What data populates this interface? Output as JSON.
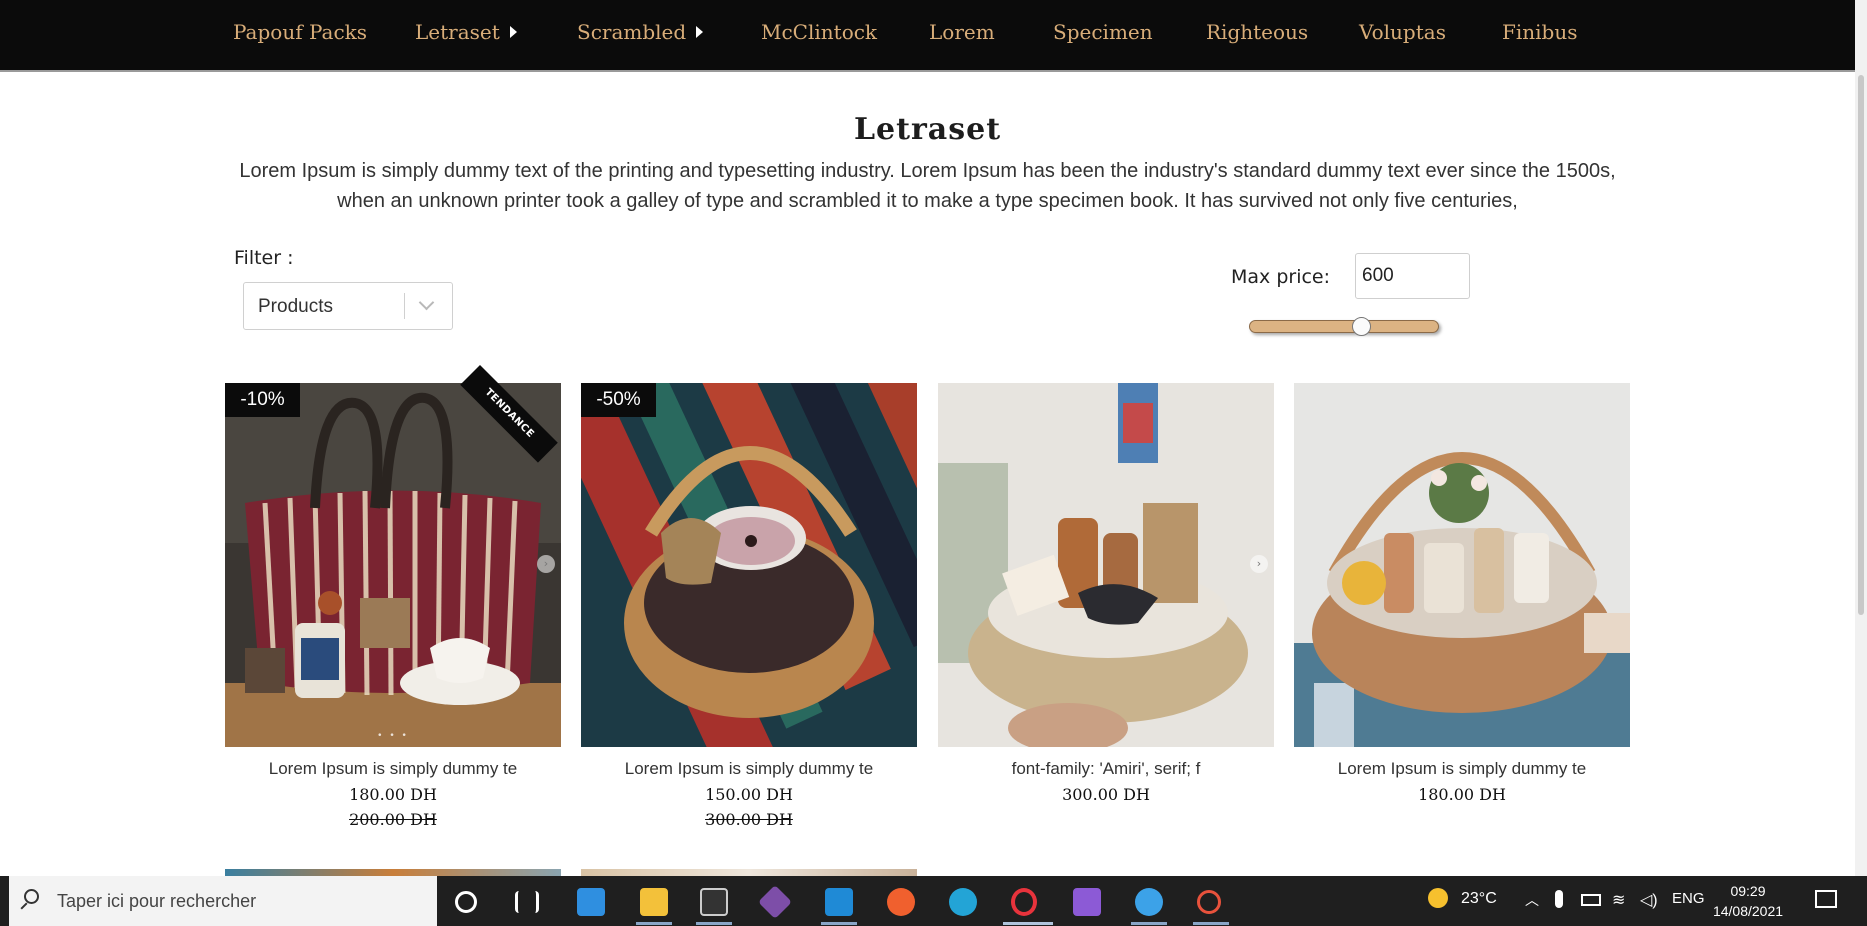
{
  "nav": {
    "items": [
      {
        "label": "Papouf Packs",
        "has_submenu": false
      },
      {
        "label": "Letraset",
        "has_submenu": true
      },
      {
        "label": "Scrambled",
        "has_submenu": true
      },
      {
        "label": "McClintock",
        "has_submenu": false
      },
      {
        "label": "Lorem",
        "has_submenu": false
      },
      {
        "label": "Specimen",
        "has_submenu": false
      },
      {
        "label": "Righteous",
        "has_submenu": false
      },
      {
        "label": "Voluptas",
        "has_submenu": false
      },
      {
        "label": "Finibus",
        "has_submenu": false
      }
    ],
    "text_color": "#d8ad79",
    "background": "#0b0b0b"
  },
  "page": {
    "title": "Letraset",
    "intro_line1": "Lorem Ipsum is simply dummy text of the printing and typesetting industry. Lorem Ipsum has been the industry's standard dummy text ever since the 1500s,",
    "intro_line2": "when an unknown printer took a galley of type and scrambled it to make a type specimen book. It has survived not only five centuries,"
  },
  "filter": {
    "label": "Filter :",
    "selected": "Products"
  },
  "price": {
    "label": "Max price:",
    "value": "600",
    "slider_fraction": 0.6
  },
  "products": [
    {
      "title": "Lorem Ipsum is simply dummy te",
      "price": "180.00 DH",
      "old_price": "200.00 DH",
      "discount": "-10%",
      "ribbon": "TENDANCE"
    },
    {
      "title": "Lorem Ipsum is simply dummy te",
      "price": "150.00 DH",
      "old_price": "300.00 DH",
      "discount": "-50%",
      "ribbon": ""
    },
    {
      "title": "font-family: 'Amiri', serif; f",
      "price": "300.00 DH",
      "old_price": "",
      "discount": "",
      "ribbon": ""
    },
    {
      "title": "Lorem Ipsum is simply dummy te",
      "price": "180.00 DH",
      "old_price": "",
      "discount": "",
      "ribbon": ""
    }
  ],
  "taskbar": {
    "search_placeholder": "Taper ici pour rechercher",
    "weather": "23°C",
    "language": "ENG",
    "time": "09:29",
    "date": "14/08/2021",
    "apps": [
      "cortana-icon",
      "task-view-icon",
      "mail-icon",
      "file-explorer-icon",
      "terminal-icon",
      "git-icon",
      "vscode-icon",
      "app-orange-icon",
      "edge-icon",
      "opera-icon",
      "visual-studio-icon",
      "chat-icon",
      "snipping-icon"
    ]
  }
}
